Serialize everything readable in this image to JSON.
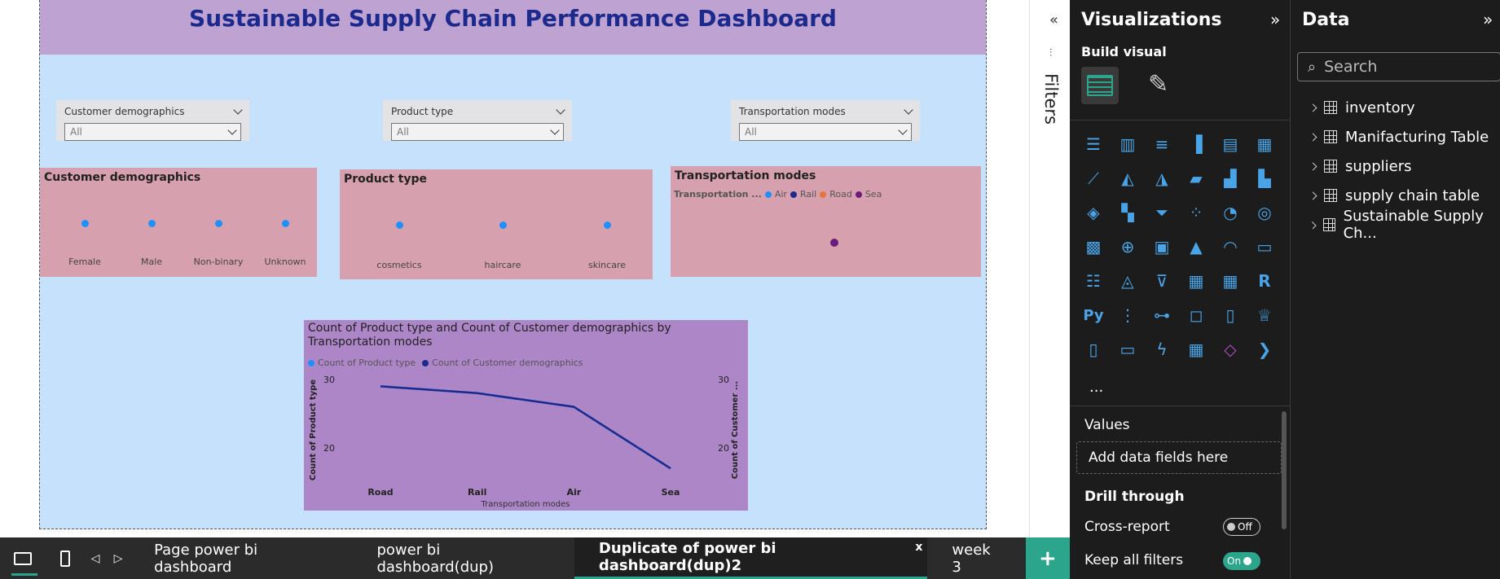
{
  "report": {
    "title": "Sustainable Supply Chain Performance Dashboard",
    "slicers": [
      {
        "label": "Customer demographics",
        "value": "All"
      },
      {
        "label": "Product type",
        "value": "All"
      },
      {
        "label": "Transportation modes",
        "value": "All"
      }
    ],
    "cards": {
      "customer": {
        "title": "Customer demographics",
        "items": [
          "Female",
          "Male",
          "Non-binary",
          "Unknown"
        ]
      },
      "product": {
        "title": "Product type",
        "items": [
          "cosmetics",
          "haircare",
          "skincare"
        ]
      },
      "transport": {
        "title": "Transportation modes",
        "legend_title": "Transportation ...",
        "legend": [
          "Air",
          "Rail",
          "Road",
          "Sea"
        ],
        "legend_colors": [
          "#1e90ff",
          "#1b2a8c",
          "#e8743b",
          "#6b1b7a"
        ]
      }
    }
  },
  "chart_data": {
    "type": "line",
    "title": "Count of Product type and Count of Customer demographics by Transportation modes",
    "categories": [
      "Road",
      "Rail",
      "Air",
      "Sea"
    ],
    "series": [
      {
        "name": "Count of Product type",
        "values": [
          29,
          28,
          26,
          17
        ],
        "color": "#1e90ff"
      },
      {
        "name": "Count of Customer demographics",
        "values": [
          29,
          28,
          26,
          17
        ],
        "color": "#1b2a8c"
      }
    ],
    "xlabel": "Transportation modes",
    "ylabel": "Count of Product type",
    "y2label": "Count of Customer ...",
    "ylim": [
      15,
      30
    ],
    "yticks": [
      "30",
      "20"
    ]
  },
  "filters_label": "Filters",
  "viz_pane": {
    "title": "Visualizations",
    "build_visual": "Build visual",
    "values_label": "Values",
    "add_fields": "Add data fields here",
    "drill_through": "Drill through",
    "cross_report": "Cross-report",
    "cross_report_state": "Off",
    "keep_filters": "Keep all filters",
    "keep_filters_state": "On",
    "more": "..."
  },
  "data_pane": {
    "title": "Data",
    "search_placeholder": "Search",
    "tables": [
      "inventory",
      "Manifacturing Table",
      "suppliers",
      "supply chain table",
      "Sustainable Supply Ch..."
    ]
  },
  "tabs": [
    {
      "label": "Page power bi dashboard",
      "active": false
    },
    {
      "label": "power bi dashboard(dup)",
      "active": false
    },
    {
      "label": "Duplicate of power bi dashboard(dup)2",
      "active": true
    },
    {
      "label": "week 3",
      "active": false
    }
  ],
  "tab_close": "x",
  "tab_add": "+"
}
